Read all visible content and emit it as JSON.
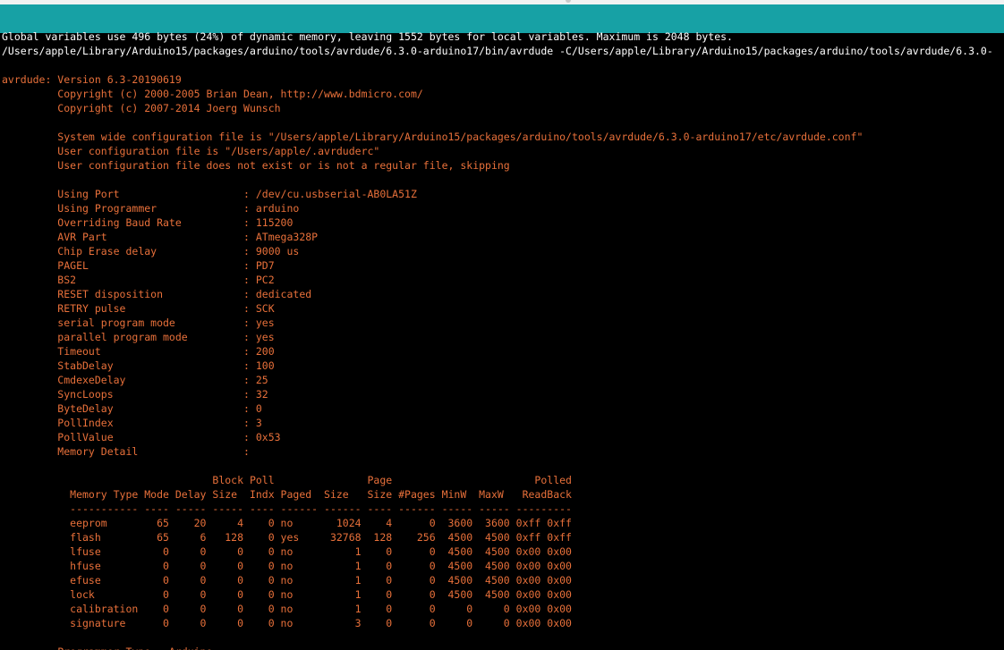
{
  "colors": {
    "header_bar": "#17a1a5",
    "console_background": "#000000",
    "info_text": "#ffffff",
    "error_text": "#e8703a"
  },
  "console_lines": [
    {
      "kind": "info",
      "text": "Global variables use 496 bytes (24%) of dynamic memory, leaving 1552 bytes for local variables. Maximum is 2048 bytes."
    },
    {
      "kind": "info",
      "text": "/Users/apple/Library/Arduino15/packages/arduino/tools/avrdude/6.3.0-arduino17/bin/avrdude -C/Users/apple/Library/Arduino15/packages/arduino/tools/avrdude/6.3.0-"
    },
    {
      "kind": "err",
      "text": ""
    },
    {
      "kind": "err",
      "text": "avrdude: Version 6.3-20190619"
    },
    {
      "kind": "err",
      "text": "         Copyright (c) 2000-2005 Brian Dean, http://www.bdmicro.com/"
    },
    {
      "kind": "err",
      "text": "         Copyright (c) 2007-2014 Joerg Wunsch"
    },
    {
      "kind": "err",
      "text": ""
    },
    {
      "kind": "err",
      "text": "         System wide configuration file is \"/Users/apple/Library/Arduino15/packages/arduino/tools/avrdude/6.3.0-arduino17/etc/avrdude.conf\""
    },
    {
      "kind": "err",
      "text": "         User configuration file is \"/Users/apple/.avrduderc\""
    },
    {
      "kind": "err",
      "text": "         User configuration file does not exist or is not a regular file, skipping"
    },
    {
      "kind": "err",
      "text": ""
    },
    {
      "kind": "err",
      "text": "         Using Port                    : /dev/cu.usbserial-AB0LA51Z"
    },
    {
      "kind": "err",
      "text": "         Using Programmer              : arduino"
    },
    {
      "kind": "err",
      "text": "         Overriding Baud Rate          : 115200"
    },
    {
      "kind": "err",
      "text": "         AVR Part                      : ATmega328P"
    },
    {
      "kind": "err",
      "text": "         Chip Erase delay              : 9000 us"
    },
    {
      "kind": "err",
      "text": "         PAGEL                         : PD7"
    },
    {
      "kind": "err",
      "text": "         BS2                           : PC2"
    },
    {
      "kind": "err",
      "text": "         RESET disposition             : dedicated"
    },
    {
      "kind": "err",
      "text": "         RETRY pulse                   : SCK"
    },
    {
      "kind": "err",
      "text": "         serial program mode           : yes"
    },
    {
      "kind": "err",
      "text": "         parallel program mode         : yes"
    },
    {
      "kind": "err",
      "text": "         Timeout                       : 200"
    },
    {
      "kind": "err",
      "text": "         StabDelay                     : 100"
    },
    {
      "kind": "err",
      "text": "         CmdexeDelay                   : 25"
    },
    {
      "kind": "err",
      "text": "         SyncLoops                     : 32"
    },
    {
      "kind": "err",
      "text": "         ByteDelay                     : 0"
    },
    {
      "kind": "err",
      "text": "         PollIndex                     : 3"
    },
    {
      "kind": "err",
      "text": "         PollValue                     : 0x53"
    },
    {
      "kind": "err",
      "text": "         Memory Detail                 :"
    },
    {
      "kind": "err",
      "text": ""
    },
    {
      "kind": "err",
      "text": "                                  Block Poll               Page                       Polled"
    },
    {
      "kind": "err",
      "text": "           Memory Type Mode Delay Size  Indx Paged  Size   Size #Pages MinW  MaxW   ReadBack"
    },
    {
      "kind": "err",
      "text": "           ----------- ---- ----- ----- ---- ------ ------ ---- ------ ----- ----- ---------"
    },
    {
      "kind": "err",
      "text": "           eeprom        65    20     4    0 no       1024    4      0  3600  3600 0xff 0xff"
    },
    {
      "kind": "err",
      "text": "           flash         65     6   128    0 yes     32768  128    256  4500  4500 0xff 0xff"
    },
    {
      "kind": "err",
      "text": "           lfuse          0     0     0    0 no          1    0      0  4500  4500 0x00 0x00"
    },
    {
      "kind": "err",
      "text": "           hfuse          0     0     0    0 no          1    0      0  4500  4500 0x00 0x00"
    },
    {
      "kind": "err",
      "text": "           efuse          0     0     0    0 no          1    0      0  4500  4500 0x00 0x00"
    },
    {
      "kind": "err",
      "text": "           lock           0     0     0    0 no          1    0      0  4500  4500 0x00 0x00"
    },
    {
      "kind": "err",
      "text": "           calibration    0     0     0    0 no          1    0      0     0     0 0x00 0x00"
    },
    {
      "kind": "err",
      "text": "           signature      0     0     0    0 no          3    0      0     0     0 0x00 0x00"
    },
    {
      "kind": "err",
      "text": ""
    },
    {
      "kind": "err",
      "text": "         Programmer Type : Arduino"
    }
  ]
}
